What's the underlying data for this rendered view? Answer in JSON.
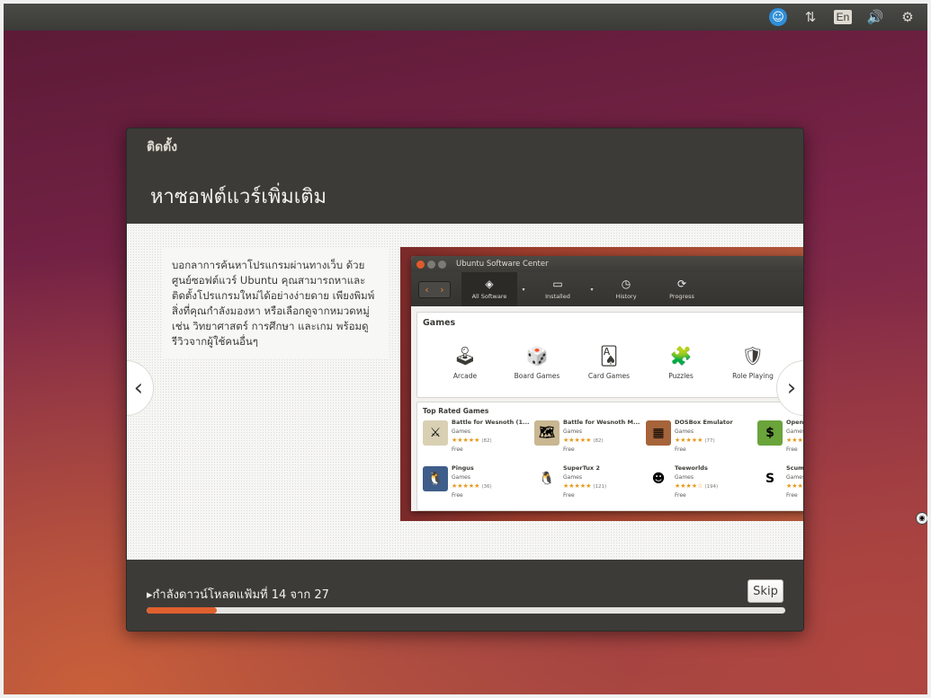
{
  "topbar": {
    "icons": [
      "accessibility-icon",
      "network-icon",
      "keyboard-layout-icon",
      "volume-icon",
      "settings-gear-icon"
    ],
    "language": "En"
  },
  "dialog": {
    "title": "ติดตั้ง",
    "heading": "หาซอฟต์แวร์เพิ่มเติม",
    "slide_text": "บอกลาการค้นหาโปรแกรมผ่านทางเว็บ ด้วยศูนย์ซอฟต์แวร์ Ubuntu คุณสามารถหาและติดตั้งโปรแกรมใหม่ได้อย่างง่ายดาย เพียงพิมพ์สิ่งที่คุณกำลังมองหา หรือเลือกดูจากหมวดหมู่ เช่น วิทยาศาสตร์ การศึกษา และเกม พร้อมดูรีวิวจากผู้ใช้คนอื่นๆ",
    "prev": "‹",
    "next": "›",
    "progress_label": "▸กำลังดาวน์โหลดแฟ้มที่ 14 จาก 27",
    "progress_fraction": 0.11,
    "skip_label": "Skip",
    "accent_color": "#e0602e"
  },
  "usc": {
    "title": "Ubuntu Software Center",
    "toolbar": {
      "all_software": "All Software",
      "installed": "Installed",
      "history": "History",
      "progress": "Progress"
    },
    "games_heading": "Games",
    "categories": [
      {
        "label": "Arcade",
        "icon": "arcade-cabinet-icon",
        "glyph": "🕹"
      },
      {
        "label": "Board Games",
        "icon": "dice-icon",
        "glyph": "🎲"
      },
      {
        "label": "Card Games",
        "icon": "cards-icon",
        "glyph": "🂡"
      },
      {
        "label": "Puzzles",
        "icon": "puzzle-icon",
        "glyph": "🧩"
      },
      {
        "label": "Role Playing",
        "icon": "role-playing-icon",
        "glyph": "🛡"
      }
    ],
    "top_rated_heading": "Top Rated Games",
    "apps": [
      {
        "name": "Battle for Wesnoth (1...",
        "category": "Games",
        "stars": "★★★★★",
        "count": "(82)",
        "price": "Free",
        "icon": "wesnoth-shield-icon",
        "glyph": "⚔",
        "bg": "#d9d0b4"
      },
      {
        "name": "Battle for Wesnoth M...",
        "category": "Games",
        "stars": "★★★★★",
        "count": "(82)",
        "price": "Free",
        "icon": "wesnoth-map-icon",
        "glyph": "🗺",
        "bg": "#c9b791"
      },
      {
        "name": "DOSBox Emulator",
        "category": "Games",
        "stars": "★★★★★",
        "count": "(77)",
        "price": "Free",
        "icon": "dosbox-icon",
        "glyph": "▦",
        "bg": "#a6643a"
      },
      {
        "name": "OpenTTD",
        "category": "Games",
        "stars": "★★★★★",
        "count": "",
        "price": "Free",
        "icon": "openttd-icon",
        "glyph": "$",
        "bg": "#6aa43b"
      },
      {
        "name": "Pingus",
        "category": "Games",
        "stars": "★★★★★",
        "count": "(36)",
        "price": "Free",
        "icon": "pingus-icon",
        "glyph": "🐧",
        "bg": "#3e5d8a"
      },
      {
        "name": "SuperTux 2",
        "category": "Games",
        "stars": "★★★★★",
        "count": "(121)",
        "price": "Free",
        "icon": "supertux-icon",
        "glyph": "🐧",
        "bg": "#ffffff"
      },
      {
        "name": "Teeworlds",
        "category": "Games",
        "stars": "★★★★☆",
        "count": "(194)",
        "price": "Free",
        "icon": "teeworlds-icon",
        "glyph": "☻",
        "bg": "#ffffff"
      },
      {
        "name": "Scummvm",
        "category": "Games",
        "stars": "★★★★★",
        "count": "",
        "price": "Free",
        "icon": "scummvm-icon",
        "glyph": "S",
        "bg": "#ffffff"
      }
    ]
  }
}
